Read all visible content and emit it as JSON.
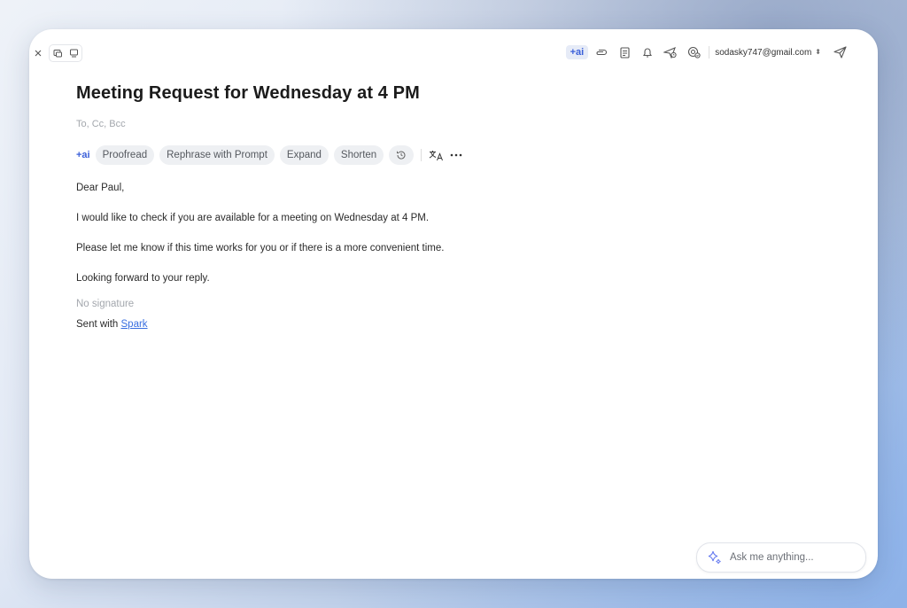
{
  "toolbar": {
    "ai_badge": "+ai",
    "account": "sodasky747@gmail.com"
  },
  "email": {
    "subject": "Meeting Request for Wednesday at 4 PM",
    "recipients_placeholder": "To, Cc, Bcc",
    "body": [
      "Dear Paul,",
      "I would like to check if you are available for a meeting on Wednesday at 4 PM.",
      "Please let me know if this time works for you or if there is a more convenient time.",
      "Looking forward to your reply."
    ],
    "signature": "No signature",
    "sent_with_prefix": "Sent with ",
    "sent_with_link": "Spark"
  },
  "ai_toolbar": {
    "label": "+ai",
    "chips": [
      "Proofread",
      "Rephrase with Prompt",
      "Expand",
      "Shorten"
    ]
  },
  "assistant": {
    "placeholder": "Ask me anything..."
  },
  "colors": {
    "accent": "#3a5fd9",
    "link": "#3a6fe0"
  }
}
